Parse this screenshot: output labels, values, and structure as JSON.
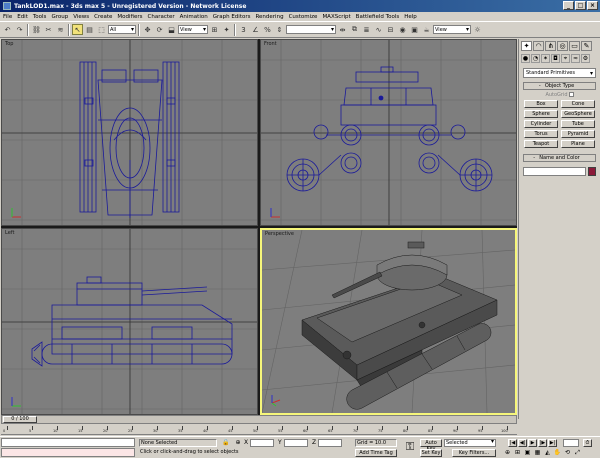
{
  "window": {
    "title": "TankLOD1.max - 3ds max 5 - Unregistered Version - Network License",
    "buttons": [
      "_",
      "□",
      "×"
    ]
  },
  "menu": [
    "File",
    "Edit",
    "Tools",
    "Group",
    "Views",
    "Create",
    "Modifiers",
    "Character",
    "Animation",
    "Graph Editors",
    "Rendering",
    "Customize",
    "MAXScript",
    "Battlefield Tools",
    "Help"
  ],
  "toolbar": {
    "selection_filter": "All",
    "ref_coord": "View",
    "named_selection": ""
  },
  "viewports": {
    "top": "Top",
    "front": "Front",
    "left": "Left",
    "perspective": "Perspective"
  },
  "command_panel": {
    "view_dropdown": "View",
    "category": "Standard Primitives",
    "object_type_title": "Object Type",
    "autogrid": "AutoGrid",
    "objects": [
      "Box",
      "Cone",
      "Sphere",
      "GeoSphere",
      "Cylinder",
      "Tube",
      "Torus",
      "Pyramid",
      "Teapot",
      "Plane"
    ],
    "name_color_title": "Name and Color",
    "object_color": "#8b1a3a"
  },
  "timeline": {
    "slider": "0 / 100",
    "ticks": [
      "0",
      "5",
      "10",
      "15",
      "20",
      "25",
      "30",
      "35",
      "40",
      "45",
      "50",
      "55",
      "60",
      "65",
      "70",
      "75",
      "80",
      "85",
      "90",
      "95",
      "100"
    ]
  },
  "status": {
    "selection": "None Selected",
    "prompt": "Click or click-and-drag to select objects",
    "coord_x": "X",
    "coord_y": "Y",
    "coord_z": "Z",
    "grid": "Grid = 10.0",
    "add_time_tag": "Add Time Tag",
    "auto_key": "Auto Key",
    "set_key": "Set Key",
    "selected": "Selected",
    "key_filters": "Key Filters..."
  }
}
